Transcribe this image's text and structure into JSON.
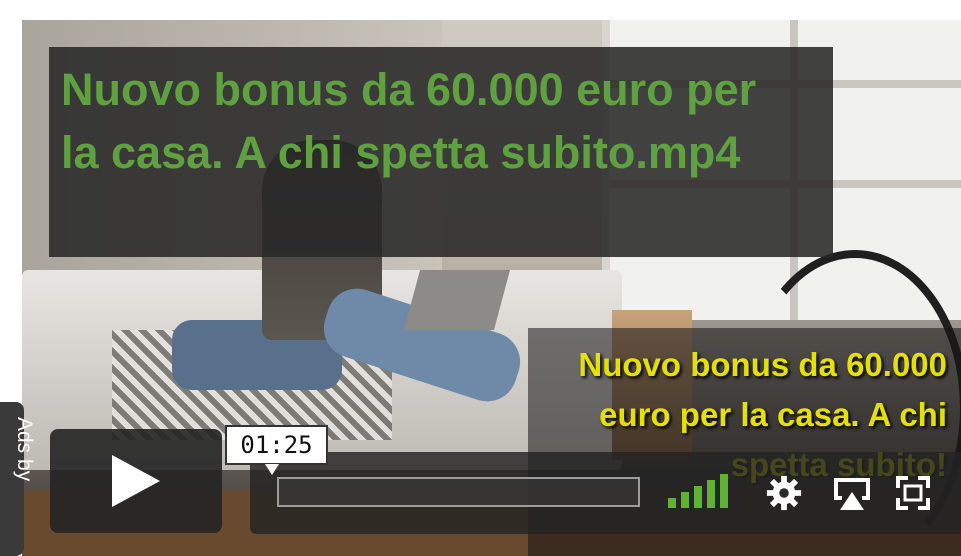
{
  "title": "Nuovo bonus da 60.000 euro per la casa. A chi spetta subito.mp4",
  "caption": "Nuovo bonus da 60.000 euro per la casa. A chi spetta subito!",
  "player": {
    "time_tooltip": "01:25",
    "progress": 0,
    "icons": {
      "play": "play-icon",
      "volume": "volume-icon",
      "settings": "gear-icon",
      "airplay": "airplay-icon",
      "fullscreen": "fullscreen-icon"
    },
    "ads_label": "Ads by"
  },
  "colors": {
    "title": "#5fa040",
    "caption": "#e4e000",
    "volume": "#5fb233"
  }
}
